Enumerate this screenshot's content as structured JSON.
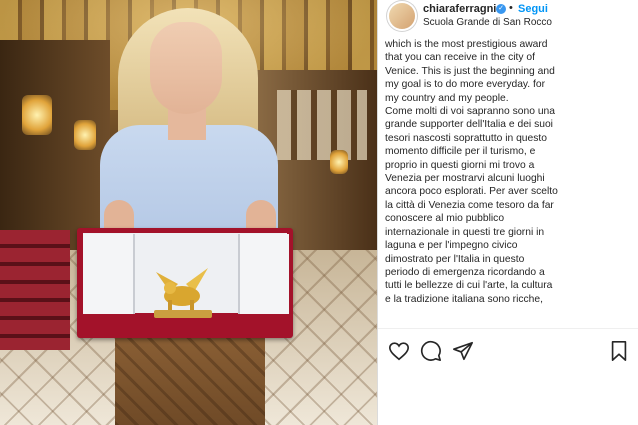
{
  "post": {
    "username": "chiaraferragni",
    "follow_label": "Segui",
    "separator": "•",
    "location": "Scuola Grande di San Rocco",
    "caption_lines": [
      "which is the most prestigious award",
      "that you can receive in the city of",
      "Venice. This is just the beginning and",
      "my goal is to do more everyday. for",
      "my country and my people.",
      "Come molti di voi sapranno sono una",
      "grande supporter dell'Italia e dei suoi",
      "tesori nascosti soprattutto in questo",
      "momento difficile per il turismo, e",
      "proprio in questi giorni mi trovo a",
      "Venezia per mostrarvi alcuni luoghi",
      "ancora poco esplorati. Per aver scelto",
      "la città di Venezia come tesoro da far",
      "conoscere al mio pubblico",
      "internazionale in questi tre giorni in",
      "laguna e per l'impegno civico",
      "dimostrato per l'Italia in questo",
      "periodo di emergenza ricordando a",
      "tutti le bellezze di cui l'arte, la cultura",
      "e la tradizione italiana sono ricche,"
    ]
  },
  "icons": {
    "verified": "verified-badge-icon",
    "like": "heart-icon",
    "comment": "comment-icon",
    "share": "paper-plane-icon",
    "save": "bookmark-icon"
  },
  "colors": {
    "link_blue": "#0095f6",
    "verified_blue": "#3897f0",
    "text": "#262626"
  }
}
